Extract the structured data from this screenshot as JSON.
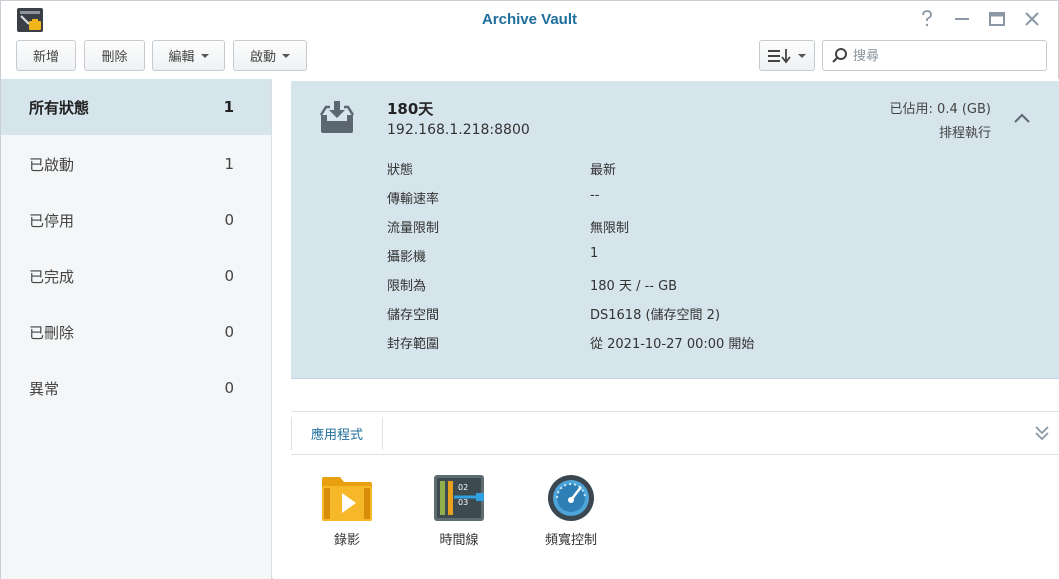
{
  "window": {
    "title": "Archive Vault",
    "icons": [
      "app-logo-icon",
      "help-icon",
      "minimize-icon",
      "maximize-icon",
      "close-icon"
    ]
  },
  "toolbar": {
    "create_label": "新增",
    "delete_label": "刪除",
    "edit_label": "編輯",
    "enable_label": "啟動",
    "sort_icon": "sort-list-icon",
    "search_placeholder": "搜尋"
  },
  "sidebar": {
    "items": [
      {
        "label": "所有狀態",
        "count": "1",
        "active": true
      },
      {
        "label": "已啟動",
        "count": "1",
        "active": false
      },
      {
        "label": "已停用",
        "count": "0",
        "active": false
      },
      {
        "label": "已完成",
        "count": "0",
        "active": false
      },
      {
        "label": "已刪除",
        "count": "0",
        "active": false
      },
      {
        "label": "異常",
        "count": "0",
        "active": false
      }
    ]
  },
  "task": {
    "icon": "archive-inbox-icon",
    "title": "180天",
    "address": "192.168.1.218:8800",
    "usage": "已佔用: 0.4 (GB)",
    "schedule": "排程執行",
    "details": [
      {
        "label": "狀態",
        "value": "最新"
      },
      {
        "label": "傳輸速率",
        "value": "--"
      },
      {
        "label": "流量限制",
        "value": "無限制"
      },
      {
        "label": "攝影機",
        "value": "1"
      },
      {
        "label": "限制為",
        "value": "180 天 / -- GB"
      },
      {
        "label": "儲存空間",
        "value": "DS1618 (儲存空間 2)"
      },
      {
        "label": "封存範圍",
        "value": "從 2021-10-27 00:00 開始"
      }
    ]
  },
  "apps": {
    "tab_label": "應用程式",
    "items": [
      {
        "label": "錄影",
        "icon": "recording-folder-icon"
      },
      {
        "label": "時間線",
        "icon": "timeline-icon"
      },
      {
        "label": "頻寬控制",
        "icon": "bandwidth-gauge-icon"
      }
    ]
  },
  "colors": {
    "accent": "#1f6e9b",
    "selected_bg": "#d6e4ec",
    "sidebar_bg": "#f4f6f7"
  }
}
